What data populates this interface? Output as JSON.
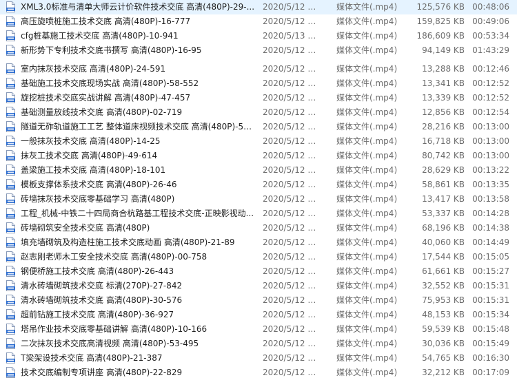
{
  "rows": [
    {
      "name": "XML3.0标准与清单大师云计价软件技术交底 高清(480P)-29-...",
      "date": "2020/5/12 星期...",
      "type": "媒体文件(.mp4)",
      "size": "125,576 KB",
      "duration": "00:48:06"
    },
    {
      "name": "高压旋喷桩施工技术交底 高清(480P)-16-777",
      "date": "2020/5/12 星期...",
      "type": "媒体文件(.mp4)",
      "size": "159,825 KB",
      "duration": "00:49:06"
    },
    {
      "name": "cfg桩基施工技术交底 高清(480P)-10-941",
      "date": "2020/5/13 星期...",
      "type": "媒体文件(.mp4)",
      "size": "186,609 KB",
      "duration": "00:53:34"
    },
    {
      "name": "新形势下专利技术交底书撰写 高清(480P)-16-95",
      "date": "2020/5/12 星期...",
      "type": "媒体文件(.mp4)",
      "size": "94,149 KB",
      "duration": "01:43:29"
    },
    {
      "name": "室内抹灰技术交底 高清(480P)-24-591",
      "date": "2020/5/12 星期...",
      "type": "媒体文件(.mp4)",
      "size": "13,288 KB",
      "duration": "00:12:46"
    },
    {
      "name": "基础施工技术交底现场实战 高清(480P)-58-552",
      "date": "2020/5/12 星期...",
      "type": "媒体文件(.mp4)",
      "size": "13,341 KB",
      "duration": "00:12:52"
    },
    {
      "name": "旋挖桩技术交底实战讲解 高清(480P)-47-457",
      "date": "2020/5/12 星期...",
      "type": "媒体文件(.mp4)",
      "size": "13,339 KB",
      "duration": "00:12:52"
    },
    {
      "name": "基础测量放线技术交底 高清(480P)-02-719",
      "date": "2020/5/12 星期...",
      "type": "媒体文件(.mp4)",
      "size": "12,856 KB",
      "duration": "00:12:54"
    },
    {
      "name": "隧道无砟轨道施工工艺 整体道床视频技术交底 高清(480P)-51...",
      "date": "2020/5/12 星期...",
      "type": "媒体文件(.mp4)",
      "size": "28,216 KB",
      "duration": "00:13:00"
    },
    {
      "name": "一般抹灰技术交底 高清(480P)-14-25",
      "date": "2020/5/12 星期...",
      "type": "媒体文件(.mp4)",
      "size": "16,718 KB",
      "duration": "00:13:00"
    },
    {
      "name": "抹灰工技术交底 高清(480P)-49-614",
      "date": "2020/5/12 星期...",
      "type": "媒体文件(.mp4)",
      "size": "80,742 KB",
      "duration": "00:13:00"
    },
    {
      "name": "盖梁施工技术交底 高清(480P)-18-101",
      "date": "2020/5/12 星期...",
      "type": "媒体文件(.mp4)",
      "size": "28,629 KB",
      "duration": "00:13:22"
    },
    {
      "name": "模板支撑体系技术交底 高清(480P)-26-46",
      "date": "2020/5/12 星期...",
      "type": "媒体文件(.mp4)",
      "size": "58,861 KB",
      "duration": "00:13:35"
    },
    {
      "name": "砖墙抹灰技术交底零基础学习 高清(480P)",
      "date": "2020/5/12 星期...",
      "type": "媒体文件(.mp4)",
      "size": "13,417 KB",
      "duration": "00:13:58"
    },
    {
      "name": "工程_机械-中铁二十四局商合杭路基工程技术交底-正映影视动...",
      "date": "2020/5/12 星期...",
      "type": "媒体文件(.mp4)",
      "size": "53,337 KB",
      "duration": "00:14:28"
    },
    {
      "name": "砖墙砌筑安全技术交底 高清(480P)",
      "date": "2020/5/12 星期...",
      "type": "媒体文件(.mp4)",
      "size": "68,196 KB",
      "duration": "00:14:38"
    },
    {
      "name": "填充墙砌筑及构造柱施工技术交底动画 高清(480P)-21-89",
      "date": "2020/5/12 星期...",
      "type": "媒体文件(.mp4)",
      "size": "40,060 KB",
      "duration": "00:14:49"
    },
    {
      "name": "赵志刚老师木工安全技术交底 高清(480P)-00-758",
      "date": "2020/5/12 星期...",
      "type": "媒体文件(.mp4)",
      "size": "17,544 KB",
      "duration": "00:15:05"
    },
    {
      "name": "钢便桥施工技术交底 高清(480P)-26-443",
      "date": "2020/5/12 星期...",
      "type": "媒体文件(.mp4)",
      "size": "61,661 KB",
      "duration": "00:15:27"
    },
    {
      "name": "清水砖墙砌筑技术交底 标清(270P)-27-842",
      "date": "2020/5/12 星期...",
      "type": "媒体文件(.mp4)",
      "size": "32,552 KB",
      "duration": "00:15:31"
    },
    {
      "name": "清水砖墙砌筑技术交底 高清(480P)-30-576",
      "date": "2020/5/12 星期...",
      "type": "媒体文件(.mp4)",
      "size": "75,953 KB",
      "duration": "00:15:31"
    },
    {
      "name": "超前钻施工技术交底 高清(480P)-36-927",
      "date": "2020/5/12 星期...",
      "type": "媒体文件(.mp4)",
      "size": "48,153 KB",
      "duration": "00:15:34"
    },
    {
      "name": "塔吊作业技术交底零基础讲解 高清(480P)-10-166",
      "date": "2020/5/12 星期...",
      "type": "媒体文件(.mp4)",
      "size": "59,539 KB",
      "duration": "00:15:48"
    },
    {
      "name": "二次抹灰技术交底高清视频 高清(480P)-53-495",
      "date": "2020/5/12 星期...",
      "type": "媒体文件(.mp4)",
      "size": "30,036 KB",
      "duration": "00:15:49"
    },
    {
      "name": "T梁架设技术交底 高清(480P)-21-387",
      "date": "2020/5/12 星期...",
      "type": "媒体文件(.mp4)",
      "size": "54,765 KB",
      "duration": "00:16:30"
    },
    {
      "name": "技术交底编制专项讲座 高清(480P)-22-829",
      "date": "2020/5/12 星期...",
      "type": "媒体文件(.mp4)",
      "size": "32,212 KB",
      "duration": "00:17:09"
    }
  ]
}
